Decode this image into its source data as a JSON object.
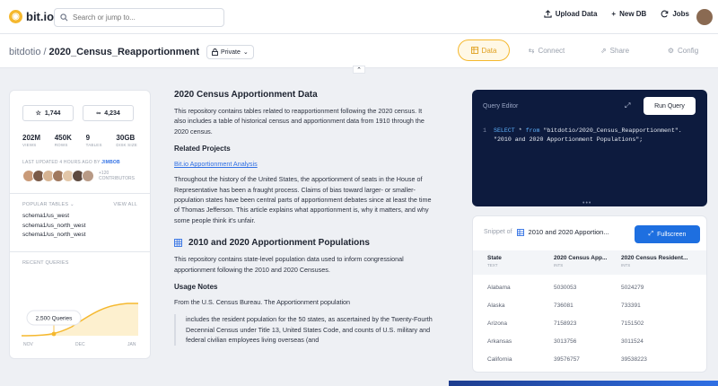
{
  "topbar": {
    "logo_text": "bit.io",
    "search_placeholder": "Search or jump to...",
    "actions": [
      {
        "label": "Upload Data",
        "icon": "upload-icon"
      },
      {
        "label": "New DB",
        "icon": "plus-icon"
      },
      {
        "label": "Jobs",
        "icon": "refresh-icon"
      }
    ]
  },
  "breadcrumb": {
    "owner": "bitdotio",
    "separator": "/",
    "repo": "2020_Census_Reapportionment",
    "visibility": "Private"
  },
  "tabs": [
    {
      "label": "Data",
      "icon": "database-icon",
      "active": true
    },
    {
      "label": "Connect",
      "icon": "arrows-icon",
      "active": false
    },
    {
      "label": "Share",
      "icon": "share-icon",
      "active": false
    },
    {
      "label": "Config",
      "icon": "gear-icon",
      "active": false
    }
  ],
  "repo_stats": {
    "stars": "1,744",
    "forks": "4,234",
    "stats": [
      {
        "value": "202M",
        "label": "VIEWS"
      },
      {
        "value": "450K",
        "label": "ROWS"
      },
      {
        "value": "9",
        "label": "TABLES"
      },
      {
        "value": "30GB",
        "label": "DISK SIZE"
      }
    ],
    "updated_text": "LAST UPDATED 4 HOURS AGO BY",
    "updated_by": "JIMBOB",
    "more_contributors": "+120",
    "contributors_label": "CONTRIBUTORS"
  },
  "popular_tables": {
    "title": "POPULAR TABLES",
    "view_all": "VIEW ALL",
    "items": [
      "schema1/us_west",
      "schema1/us_north_west",
      "schema1/us_north_west"
    ]
  },
  "recent_queries": {
    "title": "RECENT QUERIES",
    "tooltip": "2,500 Queries",
    "months": [
      "NOV",
      "DEC",
      "JAN"
    ]
  },
  "readme": {
    "title": "2020 Census Apportionment Data",
    "intro": "This repository contains tables related to reapportionment following the 2020 census. It also includes a table of historical census and apportionment data from 1910 through the 2020 census.",
    "related_heading": "Related Projects",
    "related_link": "Bit.io Apportionment Analysis",
    "history": "Throughout the history of the United States, the apportionment of seats in the House of Representative has been a fraught process. Claims of bias toward larger- or smaller-population states have been central parts of apportionment debates since at least the time of Thomas Jefferson. This article explains what apportionment is, why it matters, and why some people think it's unfair.",
    "section_title": "2010 and 2020 Apportionment Populations",
    "section_body": "This repository contains state-level population data used to inform congressional apportionment following the 2010 and 2020 Censuses.",
    "usage_heading": "Usage Notes",
    "usage_body": "From the U.S. Census Bureau. The Apportionment population",
    "quote": "includes the resident population for the 50 states, as ascertained by the Twenty-Fourth Decennial Census under Title 13, United States Code, and counts of U.S. military and federal civilian employees living overseas (and"
  },
  "query_editor": {
    "title": "Query Editor",
    "run_label": "Run Query",
    "line_number": "1",
    "code_kw1": "SELECT",
    "code_mid": " * ",
    "code_kw2": "from",
    "code_line1": " \"bitdotio/2020_Census_Reapportionment\".",
    "code_line2": "\"2010 and 2020 Apportionment Populations\";",
    "more_dots": "•••"
  },
  "snippet": {
    "label": "Snippet of",
    "table_name": "2010 and 2020 Apportion...",
    "fullscreen_label": "Fullscreen",
    "columns": [
      {
        "name": "State",
        "type": "TEXT"
      },
      {
        "name": "2020 Census App...",
        "type": "INTS"
      },
      {
        "name": "2020 Census Resident...",
        "type": "INTS"
      }
    ],
    "rows": [
      [
        "Alabama",
        "5030053",
        "5024279"
      ],
      [
        "Alaska",
        "736081",
        "733391"
      ],
      [
        "Arizona",
        "7158923",
        "7151502"
      ],
      [
        "Arkansas",
        "3013756",
        "3011524"
      ],
      [
        "California",
        "39576757",
        "39538223"
      ]
    ]
  },
  "colors": {
    "accent": "#f5b82e",
    "primary_blue": "#1e6fe0",
    "editor_bg": "#0d1b3e"
  }
}
